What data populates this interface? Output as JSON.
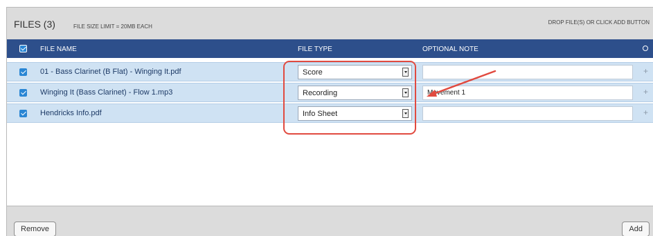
{
  "header": {
    "title": "FILES (3)",
    "size_limit": "FILE SIZE LIMIT = 20MB EACH",
    "drop_hint": "DROP FILE(S) OR CLICK ADD BUTTON"
  },
  "columns": {
    "file_name": "FILE NAME",
    "file_type": "FILE TYPE",
    "optional_note": "OPTIONAL NOTE"
  },
  "rows": [
    {
      "name": "01 - Bass Clarinet (B Flat) - Winging It.pdf",
      "type": "Score",
      "note": "",
      "checked": true
    },
    {
      "name": "Winging It (Bass Clarinet) - Flow 1.mp3",
      "type": "Recording",
      "note": "Movement 1",
      "checked": true
    },
    {
      "name": "Hendricks Info.pdf",
      "type": "Info Sheet",
      "note": "",
      "checked": true
    }
  ],
  "footer": {
    "remove_label": "Remove",
    "add_label": "Add"
  },
  "icons": {
    "row_action": "+"
  },
  "colors": {
    "header_bar": "#2d4f8b",
    "row_bg": "#cfe2f3",
    "annotation": "#e14a3f"
  }
}
